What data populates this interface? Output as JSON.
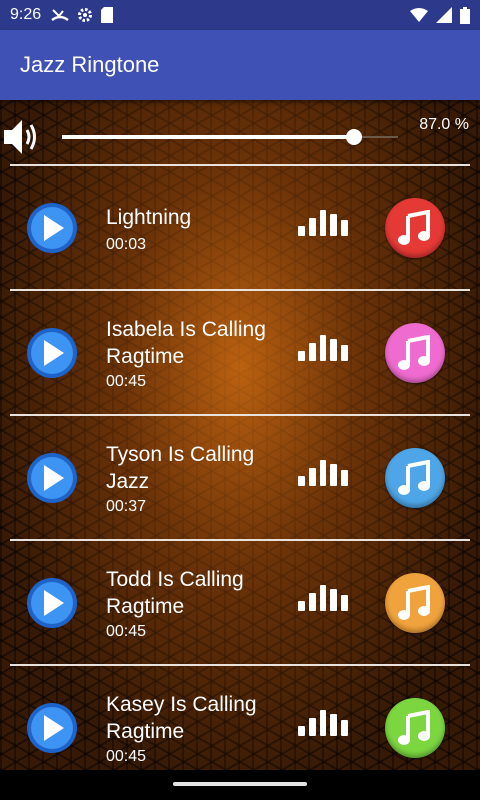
{
  "status_bar": {
    "time": "9:26",
    "icons": [
      "missed-call-icon",
      "settings-gear-icon",
      "sd-card-icon"
    ],
    "right_icons": [
      "wifi-icon",
      "signal-icon",
      "battery-icon"
    ]
  },
  "app_bar": {
    "title": "Jazz Ringtone"
  },
  "volume": {
    "percent_label": "87.0 %",
    "level": 0.87
  },
  "ringtones": [
    {
      "title": "Lightning",
      "duration": "00:03",
      "color": "#e53935"
    },
    {
      "title": "Isabela Is Calling Ragtime",
      "duration": "00:45",
      "color": "#f06bd0"
    },
    {
      "title": "Tyson Is Calling Jazz",
      "duration": "00:37",
      "color": "#4ea6e8"
    },
    {
      "title": "Todd Is Calling Ragtime",
      "duration": "00:45",
      "color": "#f0a23c"
    },
    {
      "title": "Kasey Is Calling Ragtime",
      "duration": "00:45",
      "color": "#7bd640"
    }
  ]
}
